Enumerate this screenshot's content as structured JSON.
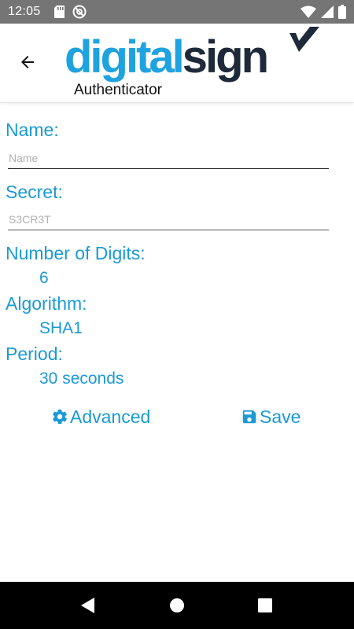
{
  "status_bar": {
    "time": "12:05",
    "left_icons": [
      "sd-card-icon",
      "do-not-disturb-icon"
    ],
    "right_icons": [
      "wifi-icon",
      "cell-signal-icon",
      "battery-icon"
    ]
  },
  "header": {
    "back_icon": "arrow-left-icon",
    "logo_text_part1": "digital",
    "logo_text_part2": "sign",
    "subtitle": "Authenticator"
  },
  "form": {
    "name_label": "Name:",
    "name_placeholder": "Name",
    "name_value": "",
    "secret_label": "Secret:",
    "secret_placeholder": "S3CR3T",
    "secret_value": "",
    "digits_label": "Number of Digits:",
    "digits_value": "6",
    "algorithm_label": "Algorithm:",
    "algorithm_value": "SHA1",
    "period_label": "Period:",
    "period_value": "30 seconds"
  },
  "actions": {
    "advanced_label": "Advanced",
    "advanced_icon": "gear-icon",
    "save_label": "Save",
    "save_icon": "floppy-disk-icon"
  },
  "nav_bar": {
    "buttons": [
      "back-triangle-icon",
      "home-circle-icon",
      "recents-square-icon"
    ]
  },
  "colors": {
    "accent": "#1b9ad6",
    "logo_blue": "#1fa3e0",
    "logo_dark": "#1e2a3a",
    "status_bar": "#757575",
    "nav_bar": "#000000"
  }
}
